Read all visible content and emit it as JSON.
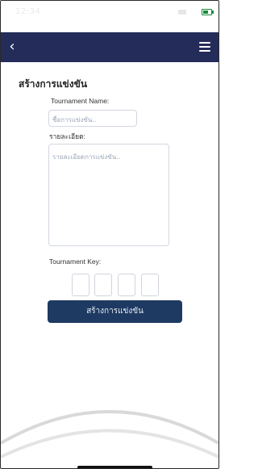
{
  "status": {
    "time": "12:34"
  },
  "form": {
    "title": "สร้างการแข่งขัน",
    "name_label": "Tournament Name:",
    "name_placeholder": "ชื่อการแข่งขัน..",
    "details_label": "รายละเอียด:",
    "details_placeholder": "รายละเอียดการแข่งขัน..",
    "key_label": "Tournament Key:",
    "key_slots": 4,
    "submit_label": "สร้างการแข่งขัน"
  },
  "colors": {
    "navbar": "#242c5a",
    "button": "#1e3a62"
  },
  "icons": {
    "back": "chevron-left-icon",
    "menu": "hamburger-menu-icon",
    "battery": "battery-icon"
  }
}
